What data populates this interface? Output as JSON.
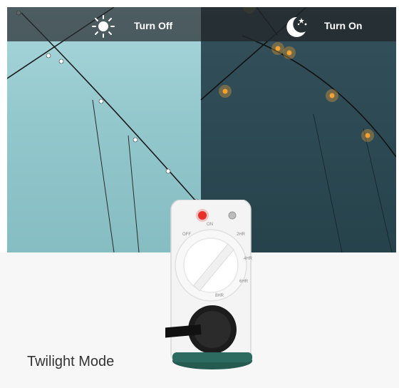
{
  "modes": {
    "day_label": "Turn Off",
    "night_label": "Turn On",
    "day_icon": "sun-icon",
    "night_icon": "moon-icon"
  },
  "device": {
    "dial_labels": [
      "OFF",
      "ON",
      "2HR",
      "4HR",
      "6HR",
      "8HR"
    ]
  },
  "caption": "Twilight Mode",
  "colors": {
    "day_sky": "#93c8cd",
    "night_sky": "#2d4a54",
    "bulb_glow": "#f2a233",
    "led": "#e8302a",
    "cap": "#245a50"
  }
}
